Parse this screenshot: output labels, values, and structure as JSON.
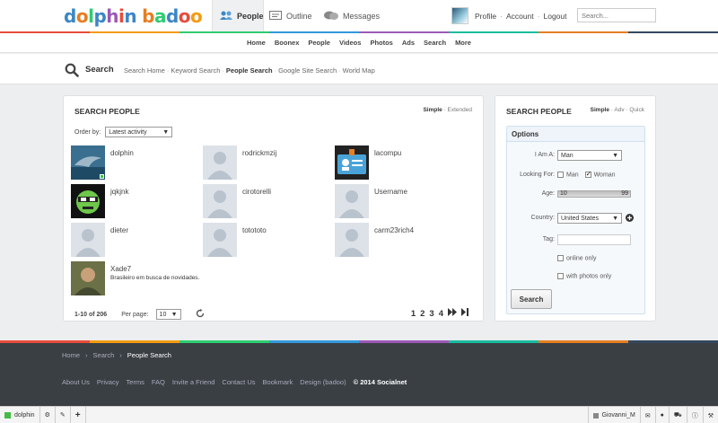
{
  "header": {
    "logo_parts": [
      "d",
      "o",
      "l",
      "p",
      "h",
      "i",
      "n",
      " ",
      "b",
      "a",
      "d",
      "o",
      "o"
    ],
    "tabs": [
      {
        "label": "People",
        "active": true,
        "icon": "people-icon"
      },
      {
        "label": "Outline",
        "active": false,
        "icon": "outline-icon"
      },
      {
        "label": "Messages",
        "active": false,
        "icon": "messages-icon"
      }
    ],
    "account_links": [
      "Profile",
      "Account",
      "Logout"
    ],
    "search_placeholder": "Search..."
  },
  "nav": [
    "Home",
    "Boonex",
    "People",
    "Videos",
    "Photos",
    "Ads",
    "Search",
    "More"
  ],
  "subheader": {
    "title": "Search",
    "links": [
      "Search Home",
      "Keyword Search",
      "People Search",
      "Google Site Search",
      "World Map"
    ],
    "current": "People Search"
  },
  "search_people": {
    "title": "SEARCH PEOPLE",
    "modes": [
      "Simple",
      "Extended"
    ],
    "order_label": "Order by:",
    "order_value": "Latest activity",
    "members": [
      {
        "name": "dolphin",
        "desc": "",
        "pic": "dolphin-photo",
        "online": true
      },
      {
        "name": "rodrickmzij",
        "desc": "",
        "pic": "default-avatar",
        "online": false
      },
      {
        "name": "lacompu",
        "desc": "",
        "pic": "id-card-photo",
        "online": false
      },
      {
        "name": "jqkjnk",
        "desc": "",
        "pic": "green-face-photo",
        "online": false
      },
      {
        "name": "cirotorelli",
        "desc": "",
        "pic": "default-avatar",
        "online": false
      },
      {
        "name": "Username",
        "desc": "",
        "pic": "default-avatar",
        "online": false
      },
      {
        "name": "dieter",
        "desc": "",
        "pic": "default-avatar",
        "online": false
      },
      {
        "name": "totototo",
        "desc": "",
        "pic": "default-avatar",
        "online": false
      },
      {
        "name": "carm23rich4",
        "desc": "",
        "pic": "default-avatar",
        "online": false
      },
      {
        "name": "Xade7",
        "desc": "Brasileiro em busca de novidades.",
        "pic": "man-photo",
        "online": false
      }
    ],
    "range_text": "1-10 of 206",
    "per_page_label": "Per page:",
    "per_page_value": "10",
    "pages": [
      "1",
      "2",
      "3",
      "4"
    ]
  },
  "search_form": {
    "title": "SEARCH PEOPLE",
    "modes": [
      "Simple",
      "Adv",
      "Quick"
    ],
    "options_title": "Options",
    "i_am_label": "I Am A:",
    "i_am_value": "Man",
    "looking_label": "Looking For:",
    "looking_man": "Man",
    "looking_woman": "Woman",
    "age_label": "Age:",
    "age_min": "10",
    "age_max": "99",
    "country_label": "Country:",
    "country_value": "United States",
    "tag_label": "Tag:",
    "online_only": "online only",
    "with_photos": "with photos only",
    "search_button": "Search"
  },
  "footer": {
    "crumbs": [
      "Home",
      "Search",
      "People Search"
    ],
    "links": [
      "About Us",
      "Privacy",
      "Terms",
      "FAQ",
      "Invite a Friend",
      "Contact Us",
      "Bookmark",
      "Design (badoo)"
    ],
    "copyright": "© 2014 Socialnet"
  },
  "bottombar": {
    "site": "dolphin",
    "user": "Giovanni_M"
  },
  "colors": {
    "accent_blue": "#3b86c6",
    "strip": [
      "#e74c3c",
      "#f39c12",
      "#2ecc71",
      "#3498db",
      "#9b59b6",
      "#1abc9c",
      "#e67e22",
      "#34495e"
    ]
  }
}
